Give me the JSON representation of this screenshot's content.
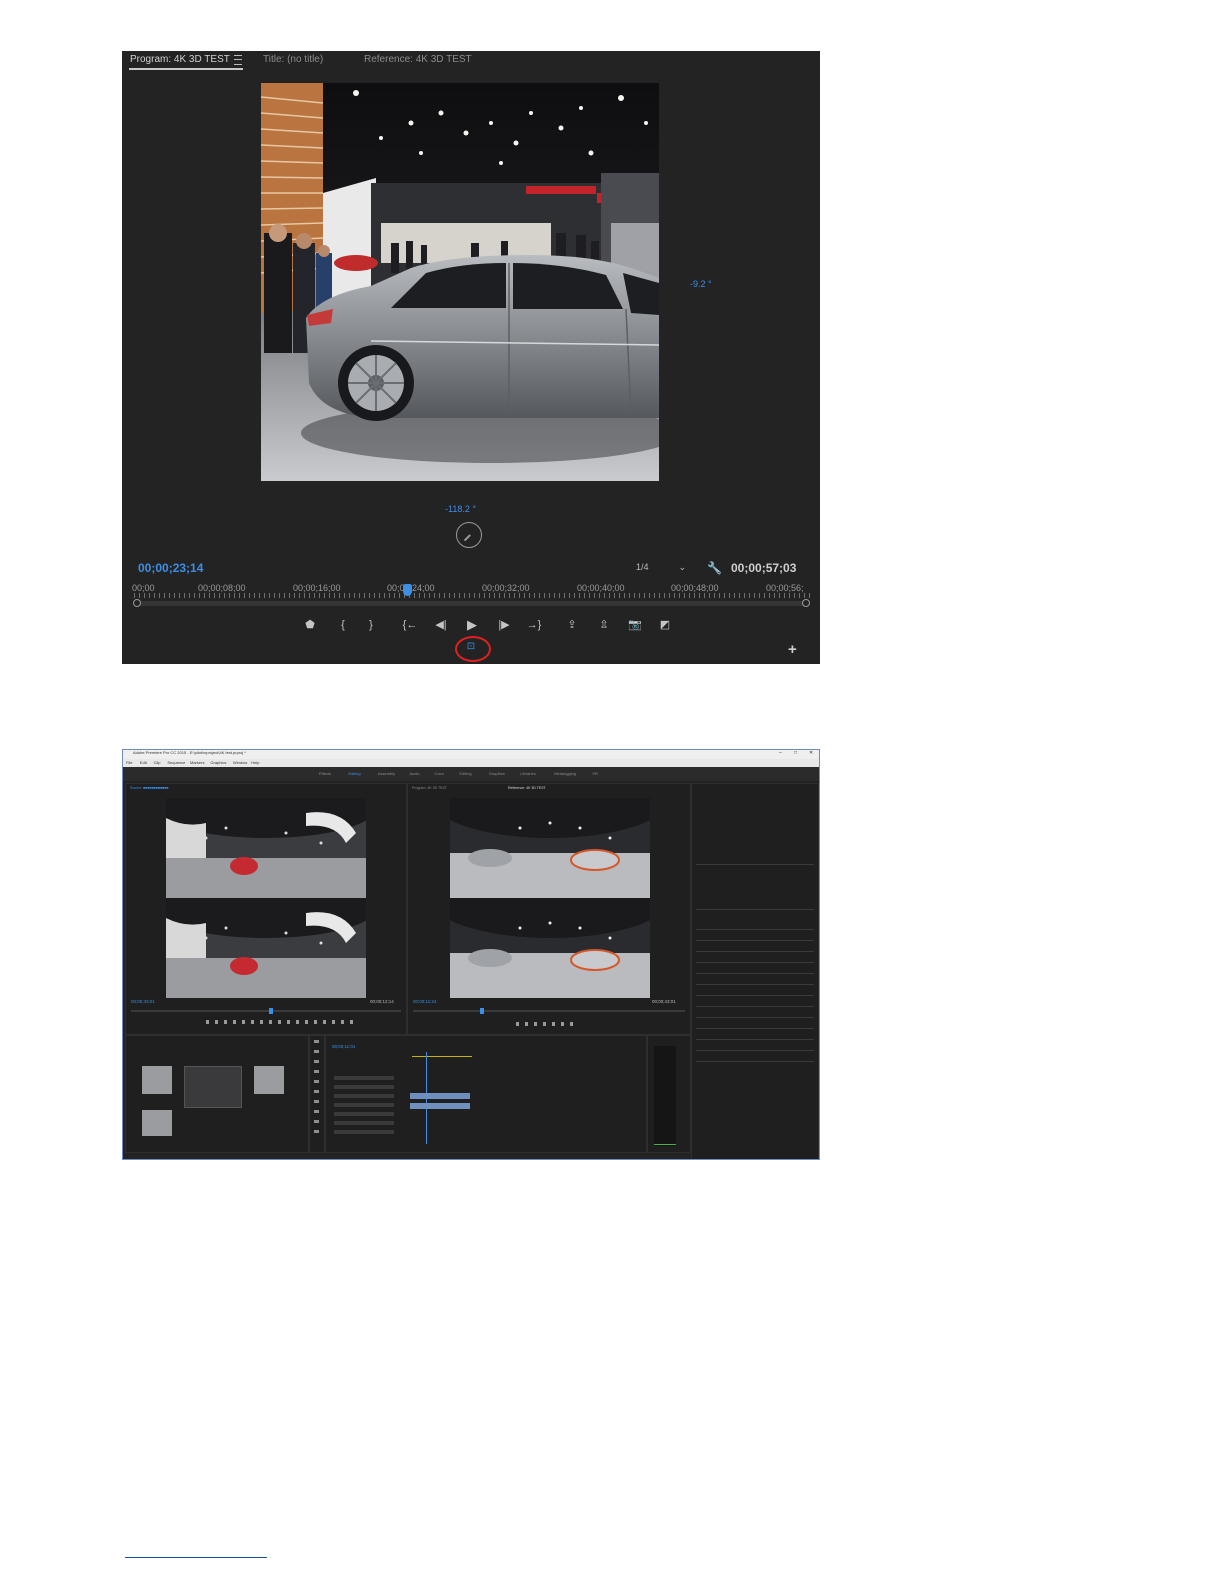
{
  "program_monitor": {
    "tabs": [
      {
        "label": "Program: 4K 3D TEST",
        "active": true
      },
      {
        "label": "Title: (no title)",
        "active": false
      },
      {
        "label": "Reference: 4K 3D TEST",
        "active": false
      }
    ],
    "vertical_angle": "-9.2 °",
    "horizontal_angle": "-118.2 °",
    "current_timecode": "00;00;23;14",
    "resolution": "1/4",
    "duration": "00;00;57;03",
    "ruler_labels": [
      "00;00",
      "00;00;08;00",
      "00;00;16;00",
      "00;00;24;00",
      "00;00;32;00",
      "00;00;40;00",
      "00;00;48;00",
      "00;00;56;"
    ],
    "playhead_position": 0.405,
    "controls": [
      {
        "name": "add-marker-button",
        "glyph": "⬟"
      },
      {
        "name": "mark-in-button",
        "glyph": "{"
      },
      {
        "name": "mark-out-button",
        "glyph": "}"
      },
      {
        "name": "go-to-in-button",
        "glyph": "{←"
      },
      {
        "name": "step-back-button",
        "glyph": "◀|"
      },
      {
        "name": "play-button",
        "glyph": "▶"
      },
      {
        "name": "step-forward-button",
        "glyph": "|▶"
      },
      {
        "name": "go-to-out-button",
        "glyph": "→}"
      },
      {
        "name": "lift-button",
        "glyph": "⇪"
      },
      {
        "name": "extract-button",
        "glyph": "⇫"
      },
      {
        "name": "export-frame-button",
        "glyph": "📷"
      },
      {
        "name": "compare-view-button",
        "glyph": "◩"
      }
    ],
    "vr_toggle_glyph": "⊡",
    "add_button_glyph": "+",
    "colors": {
      "accent": "#3d8fe6",
      "highlight": "#e02020",
      "panel": "#232323"
    }
  },
  "workspace": {
    "title": "Adobe Premiere Pro CC 2015 - E:\\pilot\\vrproject\\4K test.prproj *",
    "menu": [
      "File",
      "Edit",
      "Clip",
      "Sequence",
      "Markers",
      "Graphics",
      "Window",
      "Help"
    ],
    "workspaces": [
      "Effects",
      "Editing",
      "Assembly",
      "Audio",
      "Color",
      "Editing",
      "Graphics",
      "Libraries",
      "Metalogging",
      "VR"
    ],
    "active_workspace": 1,
    "source_timecode": "00;00;43;01",
    "source_duration": "00;00;12;14",
    "program_timecode": "00;00;11;24",
    "program_duration": "00;00;43;01",
    "timeline_timecode": "00;00;11;01"
  }
}
